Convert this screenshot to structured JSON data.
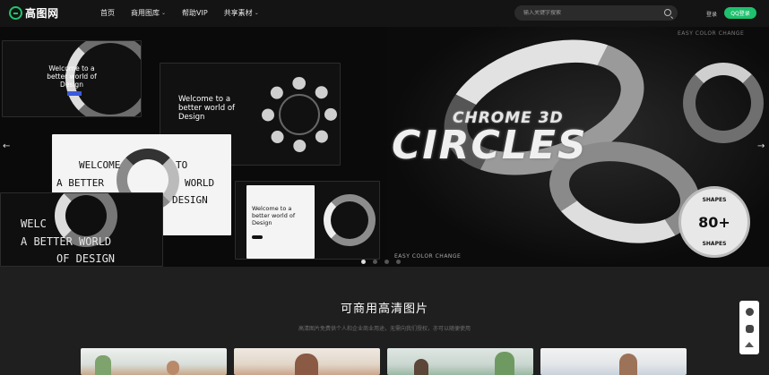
{
  "header": {
    "logo_text": "高图网",
    "nav": [
      {
        "label": "首页",
        "caret": false
      },
      {
        "label": "商用图库",
        "caret": true
      },
      {
        "label": "帮助VIP",
        "caret": false
      },
      {
        "label": "共享素材",
        "caret": true
      }
    ],
    "search": {
      "placeholder": "输入关键字搜索",
      "icon": "search-icon"
    },
    "login_label": "登录",
    "qq_login_label": "QQ登录"
  },
  "banner": {
    "cards": {
      "card1_title": "Welcome to a better world of Design",
      "card2_title": "Welcome to a better world of Design",
      "card3_l1": "WELCOME",
      "card3_l2a": "TO",
      "card3_l3a": "A BETTER",
      "card3_l3b": "WORLD",
      "card3_l4a": "OF",
      "card3_l4b": "DESIGN",
      "card4_title": "Welcome to a better world of Design",
      "card5_l1": "WELC",
      "card5_l2": "A BETTER WORLD",
      "card5_l3": "OF DESIGN"
    },
    "top_tag": "EASY COLOR CHANGE",
    "chrome_title": "CHROME 3D",
    "circles_title": "CIRCLES",
    "bottom_tag": "EASY COLOR CHANGE",
    "badge_number": "80+",
    "badge_caption": "SHAPES",
    "prev_arrow": "←",
    "next_arrow": "→",
    "slides": 4,
    "active_slide": 0
  },
  "section": {
    "title": "可商用高清图片",
    "subtitle": "高清图片免费供个人和企业商业用途，无需向我们授权，亦可以随便使用"
  },
  "theme": {
    "accent": "#1fc06e",
    "header_bg": "#141414",
    "page_bg": "#1f1f1f"
  }
}
